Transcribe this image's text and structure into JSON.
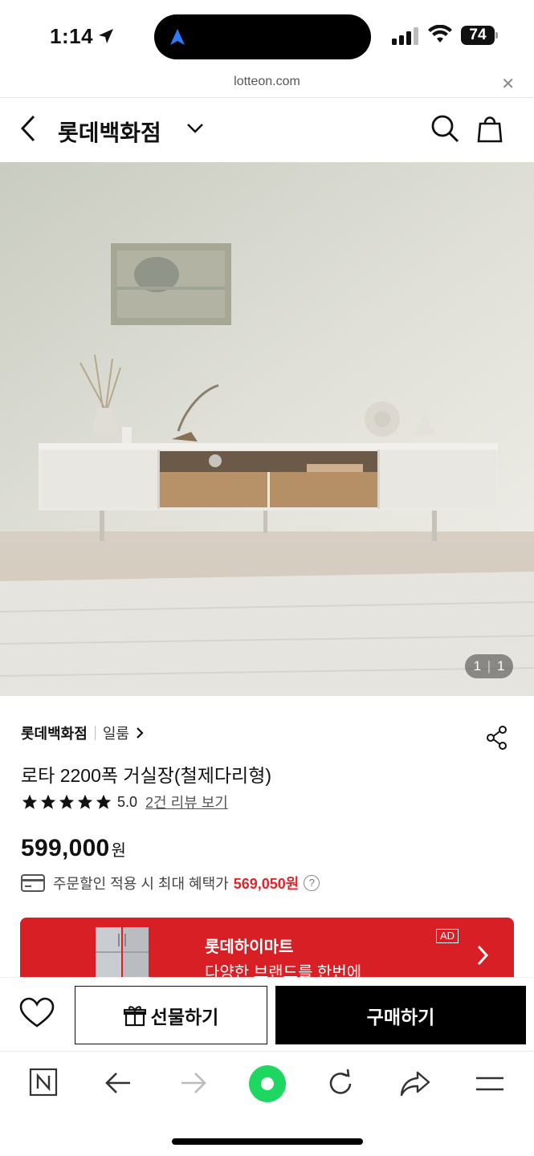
{
  "status_bar": {
    "time": "1:14",
    "battery": "74"
  },
  "browser": {
    "url": "lotteon.com"
  },
  "header": {
    "title": "롯데백화점"
  },
  "gallery": {
    "counter_current": "1",
    "counter_total": "1"
  },
  "product": {
    "store": "롯데백화점",
    "brand": "일룸",
    "name": "로타 2200폭 거실장(철제다리형)",
    "rating": "5.0",
    "rating_value": 5,
    "reviews_link": "2건 리뷰 보기",
    "price": "599,000",
    "price_unit": "원",
    "benefit_text": "주문할인 적용 시 최대 혜택가",
    "benefit_price": "569,050원",
    "help_glyph": "?"
  },
  "ad_banner": {
    "title": "롯데하이마트",
    "subtitle": "다양한 브랜드를 한번에",
    "ad_badge": "AD"
  },
  "actions": {
    "gift_label": "선물하기",
    "buy_label": "구매하기"
  },
  "colors": {
    "accent_red": "#e0252b",
    "banner_red": "#d81f26",
    "buy_black": "#000000",
    "naver_green": "#1ed760"
  },
  "icons": [
    "back-icon",
    "chevron-down-icon",
    "search-icon",
    "shopping-bag-icon",
    "share-icon",
    "star-icon",
    "card-icon",
    "help-icon",
    "heart-icon",
    "gift-icon",
    "naver-n-icon",
    "arrow-left-icon",
    "arrow-right-icon",
    "green-dot-icon",
    "reload-icon",
    "share-arrow-icon",
    "menu-icon"
  ]
}
